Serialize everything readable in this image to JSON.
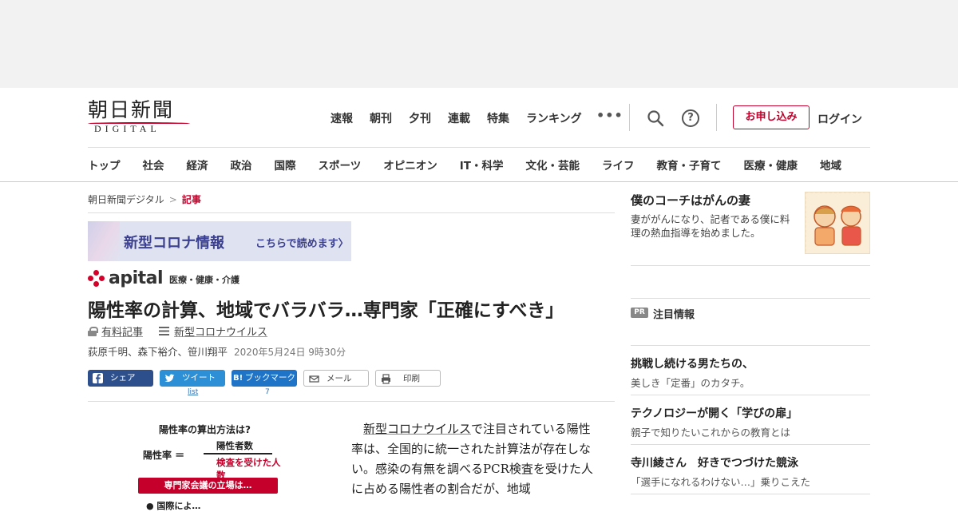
{
  "header": {
    "logo_jp": "朝日新聞",
    "logo_en": "DIGITAL",
    "top_nav": [
      "速報",
      "朝刊",
      "夕刊",
      "連載",
      "特集",
      "ランキング"
    ],
    "more_label": "•••",
    "help_glyph": "?",
    "apply_label": "お申し込み",
    "login_label": "ログイン",
    "categories": [
      "トップ",
      "社会",
      "経済",
      "政治",
      "国際",
      "スポーツ",
      "オピニオン",
      "IT・科学",
      "文化・芸能",
      "ライフ",
      "教育・子育て",
      "医療・健康",
      "地域"
    ]
  },
  "breadcrumb": {
    "home": "朝日新聞デジタル",
    "separator": ">",
    "current": "記事"
  },
  "corona_banner": {
    "title": "新型コロナ情報",
    "link": "こちらで読めます〉"
  },
  "apital": {
    "word": "apital",
    "sub": "医療・健康・介護"
  },
  "article": {
    "headline": "陽性率の計算、地域でバラバラ…専門家「正確にすべき」",
    "paid_label": "有料記事",
    "topic_label": "新型コロナウイルス",
    "authors": "荻原千明、森下裕介、笹川翔平",
    "date": "2020年5月24日 9時30分",
    "share": {
      "facebook": "シェア",
      "twitter": "ツイート",
      "twitter_sub": "list",
      "hatena": "ブックマーク",
      "hatena_badge": "B!",
      "hatena_count": "7",
      "mail": "メール",
      "print": "印刷"
    },
    "figure": {
      "title": "陽性率の算出方法は?",
      "label": "陽性率 ＝",
      "numerator": "陽性者数",
      "denominator": "検査を受けた人数",
      "band": "専門家会議の立場は…",
      "item": "● 国際によ…"
    },
    "body_indent": "　",
    "body_link": "新型コロナウイルス",
    "body_text": "で注目されている陽性率は、全国的に統一された計算法が存在しない。感染の有無を調べるPCR検査を受けた人に占める陽性者の割合だが、地域"
  },
  "sidebar": {
    "feature": {
      "title": "僕のコーチはがんの妻",
      "desc": "妻ががんになり、記者である僕に料理の熱血指導を始めました。"
    },
    "pr_badge": "PR",
    "pr_label": "注目情報",
    "pr_items": [
      {
        "headline": "挑戦し続ける男たちの、",
        "sub": "美しき「定番」のカタチ。"
      },
      {
        "headline": "テクノロジーが開く「学びの扉」",
        "sub": "親子で知りたいこれからの教育とは"
      },
      {
        "headline": "寺川綾さん　好きでつづけた競泳",
        "sub": "「選手になれるわけない…」乗りこえた"
      }
    ]
  },
  "colors": {
    "brand_red": "#c4002b",
    "facebook": "#2d4f8c",
    "twitter": "#2d8fd5",
    "hatena": "#1f74c8"
  }
}
